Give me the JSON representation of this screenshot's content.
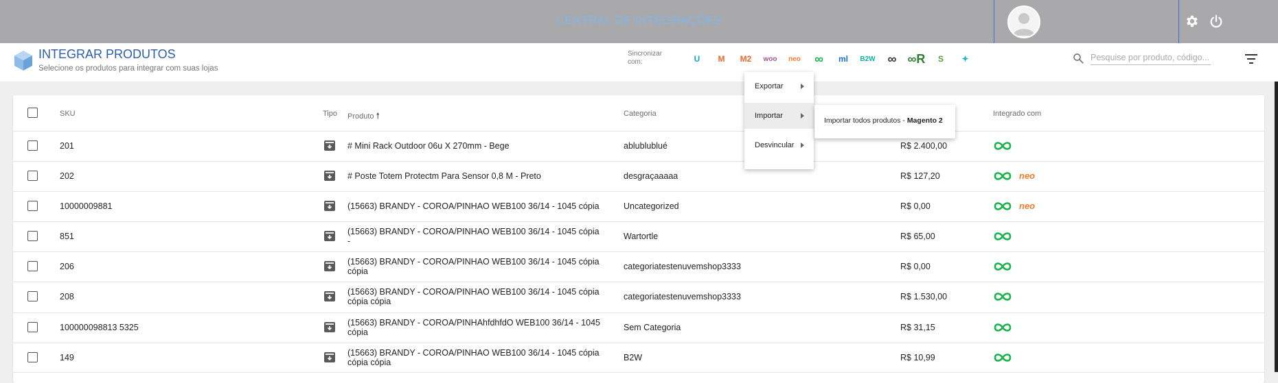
{
  "header": {
    "title": "CENTRAL DE INTEGRAÇÕES"
  },
  "page": {
    "title": "INTEGRAR PRODUTOS",
    "subtitle": "Selecione os produtos para integrar com suas lojas"
  },
  "sync": {
    "label": "Sincronizar com:",
    "stores": [
      {
        "name": "u-icon",
        "glyph": "U",
        "color": "#1aa0c8"
      },
      {
        "name": "magento-icon",
        "glyph": "M",
        "color": "#ee672f"
      },
      {
        "name": "magento2-icon",
        "glyph": "M2",
        "color": "#ee672f"
      },
      {
        "name": "woo-icon",
        "glyph": "woo",
        "color": "#96588a"
      },
      {
        "name": "neo-icon",
        "glyph": "neo",
        "color": "#f07b2b"
      },
      {
        "name": "infinity-icon",
        "glyph": "∞",
        "color": "#18b34a"
      },
      {
        "name": "ml-icon",
        "glyph": "ml",
        "color": "#1d6fc9"
      },
      {
        "name": "b2w-icon",
        "glyph": "B2W",
        "color": "#0fb4a0"
      },
      {
        "name": "link-icon",
        "glyph": "∞",
        "color": "#333333"
      },
      {
        "name": "infinity-r-icon",
        "glyph": "∞R",
        "color": "#2e7d32"
      },
      {
        "name": "shopify-icon",
        "glyph": "S",
        "color": "#5f9d3c"
      },
      {
        "name": "star-icon",
        "glyph": "✦",
        "color": "#1fb6c9"
      }
    ]
  },
  "search": {
    "placeholder": "Pesquise por produto, código..."
  },
  "table": {
    "headers": {
      "sku": "SKU",
      "tipo": "Tipo",
      "produto": "Produto",
      "categoria": "Categoria",
      "integrado": "Integrado com"
    },
    "rows": [
      {
        "sku": "201",
        "produto": [
          "# Mini Rack Outdoor 06u X 270mm - Bege"
        ],
        "categoria": "ablublublué",
        "preco": "R$ 2.400,00",
        "integ": [
          "infinity"
        ]
      },
      {
        "sku": "202",
        "produto": [
          "# Poste Totem Protectm Para Sensor 0,8 M - Preto"
        ],
        "categoria": "desgraçaaaaa",
        "preco": "R$ 127,20",
        "integ": [
          "infinity",
          "neo"
        ]
      },
      {
        "sku": "10000009881",
        "produto": [
          "(15663) BRANDY - COROA/PINHAO WEB100 36/14 - 1045 cópia"
        ],
        "categoria": "Uncategorized",
        "preco": "R$ 0,00",
        "integ": [
          "infinity",
          "neo"
        ]
      },
      {
        "sku": "851",
        "produto": [
          "(15663) BRANDY - COROA/PINHAO WEB100 36/14 - 1045 cópia",
          "-"
        ],
        "categoria": "Wartortle",
        "preco": "R$ 65,00",
        "integ": [
          "infinity"
        ]
      },
      {
        "sku": "206",
        "produto": [
          "(15663) BRANDY - COROA/PINHAO WEB100 36/14 - 1045 cópia",
          "cópia"
        ],
        "categoria": "categoriatestenuvemshop3333",
        "preco": "R$ 0,00",
        "integ": [
          "infinity"
        ]
      },
      {
        "sku": "208",
        "produto": [
          "(15663) BRANDY - COROA/PINHAO WEB100 36/14 - 1045 cópia",
          "cópia cópia"
        ],
        "categoria": "categoriatestenuvemshop3333",
        "preco": "R$ 1.530,00",
        "integ": [
          "infinity"
        ]
      },
      {
        "sku": "100000098813 5325",
        "produto": [
          "(15663) BRANDY - COROA/PINHAhfdhfdO WEB100 36/14 - 1045",
          "cópia"
        ],
        "categoria": "Sem Categoria",
        "preco": "R$ 31,15",
        "integ": [
          "infinity"
        ]
      },
      {
        "sku": "149",
        "produto": [
          "(15663) BRANDY - COROA/PINHAO WEB100 36/14 - 1045 cópia",
          "cópia cópia"
        ],
        "categoria": "B2W",
        "preco": "R$ 10,99",
        "integ": [
          "infinity"
        ]
      }
    ]
  },
  "menu": {
    "items": [
      "Exportar",
      "Importar",
      "Desvincular"
    ],
    "submenu_prefix": "Importar todos produtos - ",
    "submenu_store": "Magento 2"
  },
  "integ_labels": {
    "neo": "neo"
  }
}
